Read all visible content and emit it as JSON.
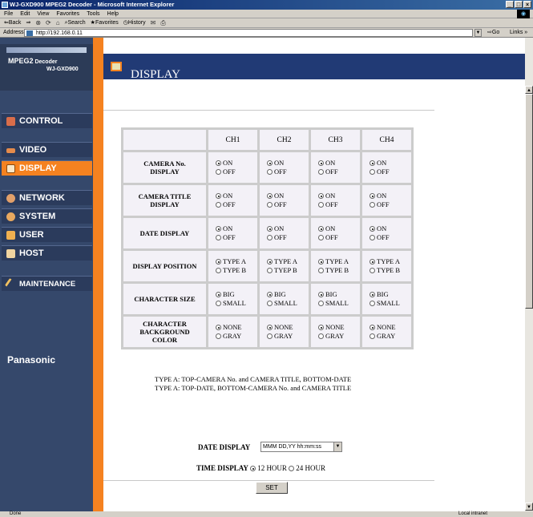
{
  "window": {
    "title": "WJ-GXD900 MPEG2 Decoder - Microsoft Internet Explorer",
    "controls": [
      "_",
      "□",
      "×"
    ]
  },
  "menu": [
    "File",
    "Edit",
    "View",
    "Favorites",
    "Tools",
    "Help"
  ],
  "toolbar": {
    "back": "⇐Back",
    "forward": "⇒",
    "search": "Search",
    "favorites": "Favorites",
    "history": "History"
  },
  "address": {
    "label": "Address",
    "url": "http://192.168.0.11",
    "go": "Go",
    "links": "Links »"
  },
  "sidebar": {
    "logo_line1": "MPEG2",
    "logo_line1_suffix": " Decoder",
    "logo_line2": "WJ-GXD900",
    "items": [
      {
        "label": "CONTROL",
        "icon": "control-icon"
      },
      {
        "label": "VIDEO",
        "icon": "video-icon"
      },
      {
        "label": "DISPLAY",
        "icon": "display-icon",
        "active": true
      },
      {
        "label": "NETWORK",
        "icon": "network-icon"
      },
      {
        "label": "SYSTEM",
        "icon": "system-icon"
      },
      {
        "label": "USER",
        "icon": "user-icon"
      },
      {
        "label": "HOST",
        "icon": "host-icon"
      },
      {
        "label": "MAINTENANCE",
        "icon": "maintenance-icon"
      }
    ],
    "brand": "Panasonic"
  },
  "page": {
    "title": "DISPLAY"
  },
  "table": {
    "channels": [
      "CH1",
      "CH2",
      "CH3",
      "CH4"
    ],
    "rows": [
      {
        "label_lines": [
          "CAMERA No.",
          "DISPLAY"
        ],
        "options": [
          "ON",
          "OFF"
        ],
        "selected": 0
      },
      {
        "label_lines": [
          "CAMERA TITLE",
          "DISPLAY"
        ],
        "options": [
          "ON",
          "OFF"
        ],
        "selected": 0
      },
      {
        "label_lines": [
          "DATE DISPLAY",
          ""
        ],
        "options": [
          "ON",
          "OFF"
        ],
        "selected": 0
      },
      {
        "label_lines": [
          "DISPLAY POSITION",
          ""
        ],
        "options": [
          "TYPE A",
          "TYPE B"
        ],
        "options_alt": {
          "1": [
            "TYPE A",
            "TYEP B"
          ]
        },
        "selected": 0
      },
      {
        "label_lines": [
          "CHARACTER SIZE",
          ""
        ],
        "options": [
          "BIG",
          "SMALL"
        ],
        "selected": 0
      },
      {
        "label_lines": [
          "CHARACTER",
          "BACKGROUND",
          "COLOR"
        ],
        "options": [
          "NONE",
          "GRAY"
        ],
        "selected": 0
      }
    ]
  },
  "notes": [
    "TYPE A: TOP-CAMERA No. and CAMERA TITLE, BOTTOM-DATE",
    "TYPE A: TOP-DATE, BOTTOM-CAMERA No. and CAMERA TITLE"
  ],
  "date_display": {
    "label": "DATE DISPLAY",
    "value": "MMM DD,YY hh:mm:ss"
  },
  "time_display": {
    "label": "TIME DISPLAY",
    "options": [
      "12 HOUR",
      "24 HOUR"
    ],
    "selected": 0
  },
  "set_button": "SET",
  "status": {
    "text": "Done",
    "zone": "Local intranet"
  },
  "colors": {
    "accent_orange": "#f58220",
    "nav_blue": "#2b3b5c",
    "header_blue": "#213a75"
  }
}
